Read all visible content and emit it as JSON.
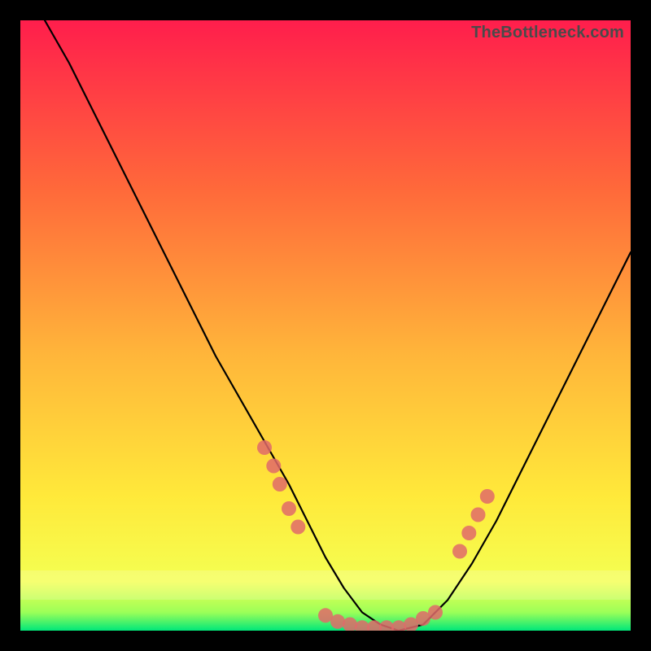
{
  "watermark": "TheBottleneck.com",
  "chart_data": {
    "type": "line",
    "title": "",
    "xlabel": "",
    "ylabel": "",
    "xlim": [
      0,
      100
    ],
    "ylim": [
      0,
      100
    ],
    "grid": false,
    "legend": false,
    "background_gradient": {
      "top_color": "#ff1e4c",
      "mid_color": "#ffd53a",
      "bottom_color": "#00e77a",
      "bottom_band_start_pct": 95
    },
    "series": [
      {
        "name": "bottleneck-curve",
        "type": "line",
        "color": "#000000",
        "x": [
          4,
          8,
          12,
          16,
          20,
          24,
          28,
          32,
          36,
          40,
          44,
          47,
          50,
          53,
          56,
          59,
          62,
          66,
          70,
          74,
          78,
          82,
          86,
          90,
          94,
          98,
          100
        ],
        "y": [
          100,
          93,
          85,
          77,
          69,
          61,
          53,
          45,
          38,
          31,
          24,
          18,
          12,
          7,
          3,
          1,
          0,
          1,
          5,
          11,
          18,
          26,
          34,
          42,
          50,
          58,
          62
        ]
      },
      {
        "name": "highlight-dots-left",
        "type": "scatter",
        "color": "#e06a6a",
        "x": [
          40,
          41.5,
          42.5,
          44,
          45.5
        ],
        "y": [
          30,
          27,
          24,
          20,
          17
        ]
      },
      {
        "name": "highlight-dots-bottom",
        "type": "scatter",
        "color": "#e06a6a",
        "x": [
          50,
          52,
          54,
          56,
          58,
          60,
          62,
          64,
          66,
          68
        ],
        "y": [
          2.5,
          1.5,
          1,
          0.5,
          0.5,
          0.5,
          0.5,
          1,
          2,
          3
        ]
      },
      {
        "name": "highlight-dots-right",
        "type": "scatter",
        "color": "#e06a6a",
        "x": [
          72,
          73.5,
          75,
          76.5
        ],
        "y": [
          13,
          16,
          19,
          22
        ]
      }
    ]
  }
}
